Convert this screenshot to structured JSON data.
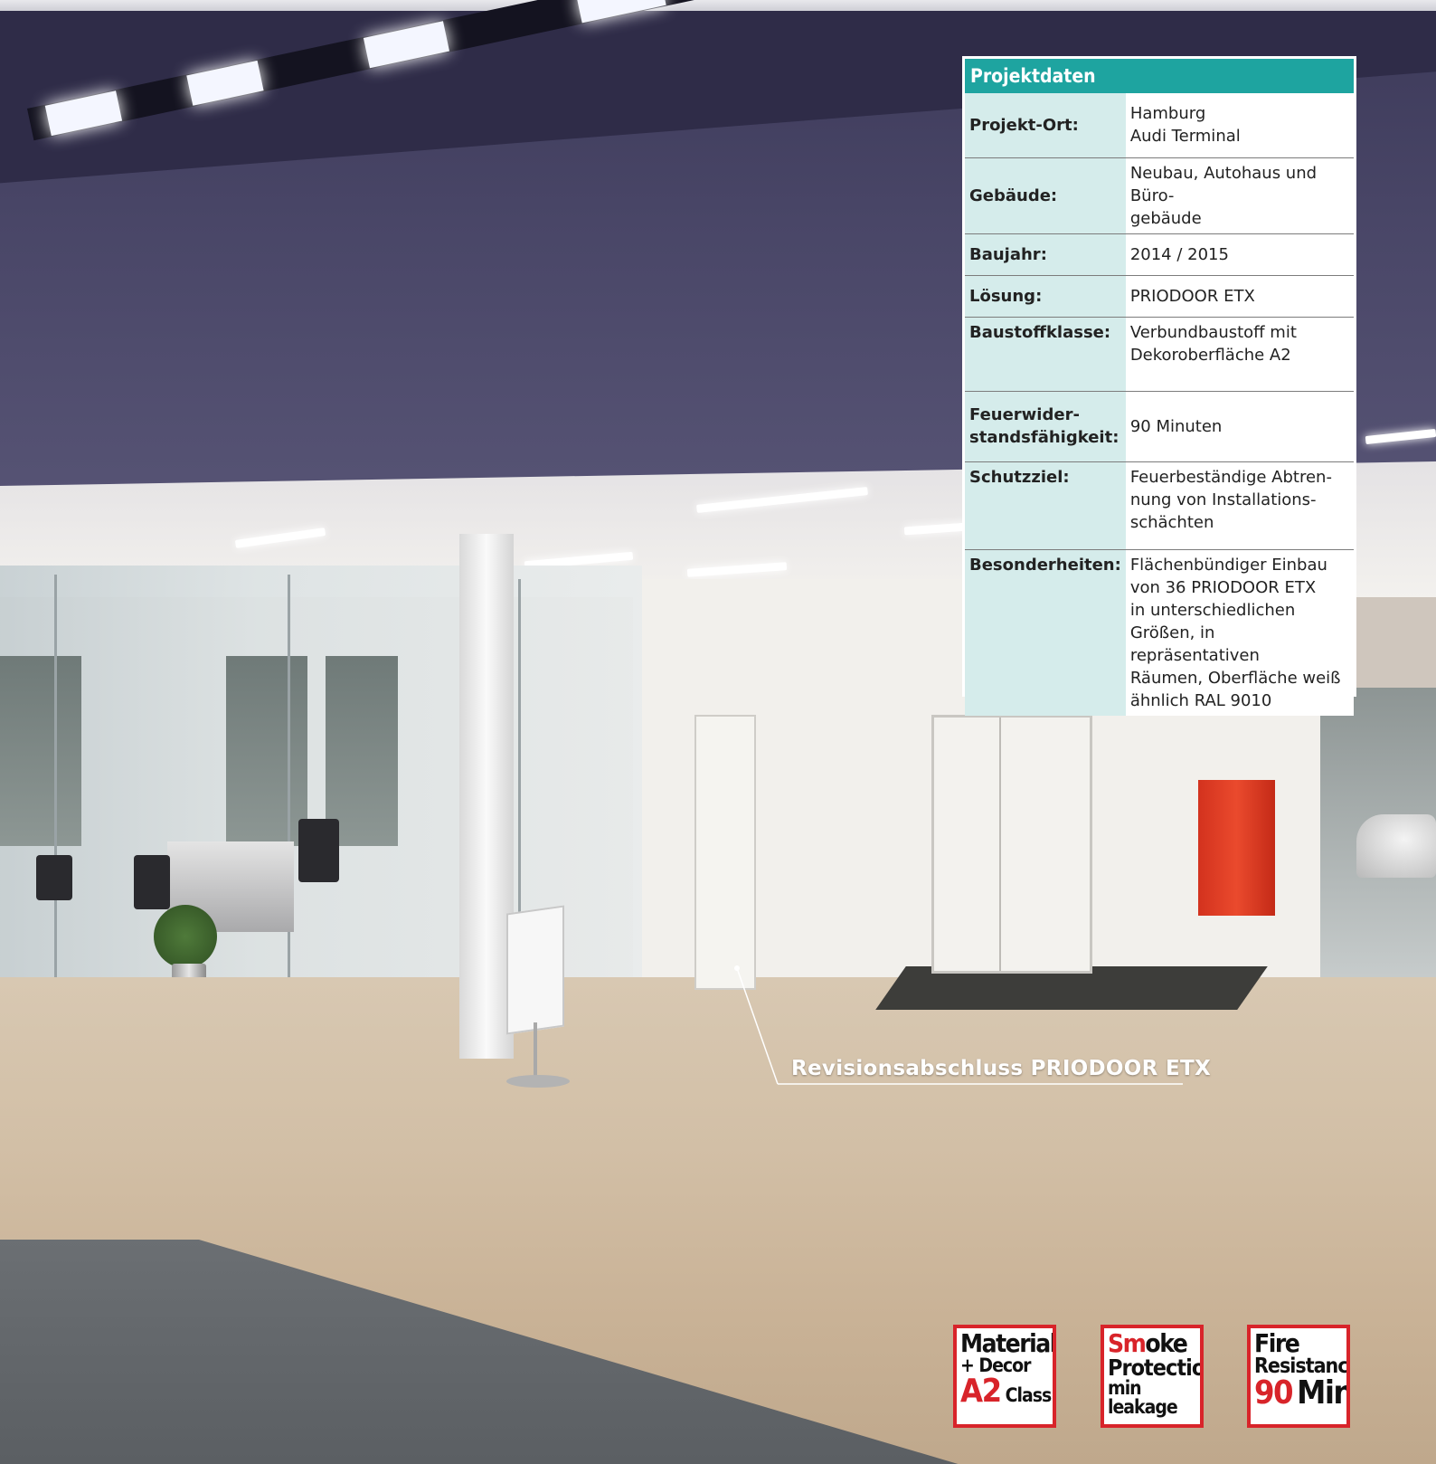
{
  "projektdaten": {
    "title": "Projektdaten",
    "rows": [
      {
        "label": "Projekt-Ort:",
        "value": "Hamburg\nAudi Terminal"
      },
      {
        "label": "Gebäude:",
        "value": "Neubau, Autohaus und Büro-\ngebäude"
      },
      {
        "label": "Baujahr:",
        "value": "2014 / 2015"
      },
      {
        "label": "Lösung:",
        "value": "PRIODOOR ETX"
      },
      {
        "label": "Baustoffklasse:",
        "value": "Verbundbaustoff mit\nDekoroberfläche A2"
      },
      {
        "label": "Feuerwider-\nstandsfähigkeit:",
        "value": "90 Minuten"
      },
      {
        "label": "Schutzziel:",
        "value": "Feuerbeständige Abtren-\nnung von Installations-\nschächten"
      },
      {
        "label": "Besonderheiten:",
        "value": "Flächenbündiger Einbau\nvon 36 PRIODOOR ETX\nin unterschiedlichen\nGrößen, in repräsentativen\nRäumen, Oberfläche weiß\nähnlich RAL 9010"
      }
    ]
  },
  "callout": {
    "text": "Revisionsabschluss PRIODOOR ETX"
  },
  "badges": {
    "material": {
      "line1": "Material",
      "line2": "+ Decor",
      "line3a": "A2",
      "line3b": "Class"
    },
    "smoke": {
      "line1a": "Sm",
      "line1b": "oke",
      "line2": "Protection",
      "line3": "min leakage"
    },
    "fire": {
      "line1": "Fire",
      "line2": "Resistance",
      "line3a": "90",
      "line3b": "Min."
    }
  },
  "colors": {
    "teal": "#1ea4a0",
    "badge_red": "#d8242a",
    "label_bg": "#d5eceb"
  }
}
